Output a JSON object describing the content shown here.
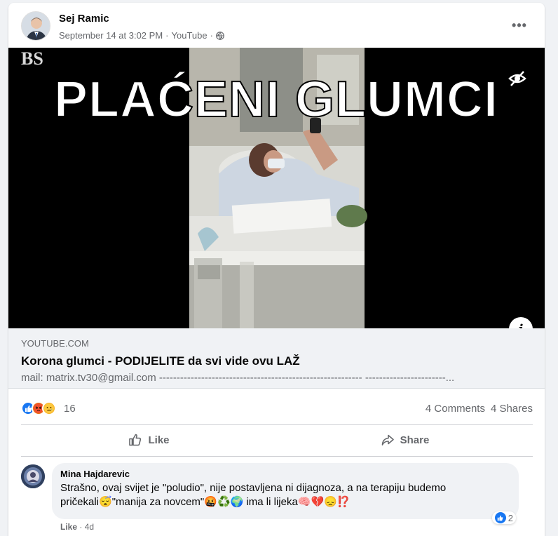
{
  "post": {
    "author": "Sej Ramic",
    "timestamp": "September 14 at 3:02 PM",
    "source": "YouTube",
    "separator": "·",
    "more_label": "•••"
  },
  "video": {
    "watermark": "BS",
    "overlay_title": "PLAĆENI GLUMCI",
    "hidden_icon": "eye-slash-icon",
    "info_label": "i"
  },
  "link": {
    "domain": "YOUTUBE.COM",
    "title": "Korona glumci - PODIJELITE da svi vide ovu LAŽ",
    "description": "mail: matrix.tv30@gmail.com ---------------------------------------------------------- -----------------------..."
  },
  "stats": {
    "reaction_count": "16",
    "comments": "4 Comments",
    "shares": "4 Shares",
    "reaction_icons": [
      "like-icon",
      "angry-icon",
      "sad-icon"
    ]
  },
  "actions": {
    "like_label": "Like",
    "share_label": "Share"
  },
  "comment": {
    "name": "Mina Hajdarevic",
    "line1": "Strašno, ovaj svijet je \"poludio\", nije postavljena ni dijagnoza, a na terapiju budemo",
    "line2_a": "pričekali",
    "emoji1": "😴",
    "line2_b": "\"manija za novcem\"",
    "emoji2": "🤬♻️🌍",
    "line2_c": " ima li lijeka",
    "emoji3": "🧠💔😞⁉️",
    "like_label": "Like",
    "age": "4d",
    "like_count": "2"
  },
  "colors": {
    "facebook_blue": "#1877f2",
    "text_secondary": "#65676b",
    "background": "#f0f2f5"
  }
}
